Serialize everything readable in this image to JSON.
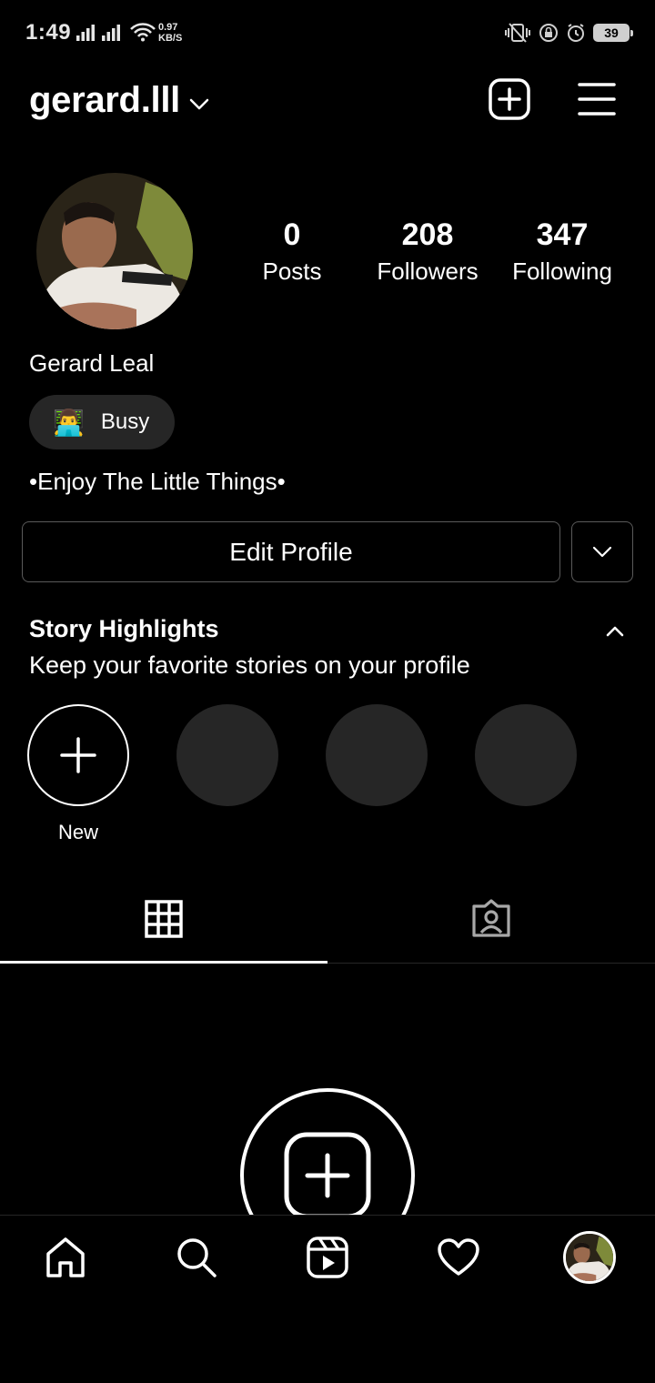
{
  "status_bar": {
    "time": "1:49",
    "net_speed_value": "0.97",
    "net_speed_unit": "KB/S",
    "battery": "39"
  },
  "header": {
    "username": "gerard.lll"
  },
  "profile": {
    "stats": [
      {
        "value": "0",
        "label": "Posts"
      },
      {
        "value": "208",
        "label": "Followers"
      },
      {
        "value": "347",
        "label": "Following"
      }
    ],
    "display_name": "Gerard Leal",
    "status_emoji": "👨‍💻",
    "status_text": "Busy",
    "bio": "•Enjoy The Little Things•",
    "edit_profile_label": "Edit Profile"
  },
  "highlights": {
    "title": "Story Highlights",
    "subtitle": "Keep your favorite stories on your profile",
    "new_label": "New"
  },
  "colors": {
    "background": "#000000",
    "placeholder_circle": "#262626",
    "border": "#5a5a5a"
  },
  "icons": {
    "header": [
      "add-post-icon",
      "menu-icon"
    ],
    "tabs": [
      "grid-icon",
      "tagged-icon"
    ],
    "nav": [
      "home-icon",
      "search-icon",
      "reels-icon",
      "heart-icon",
      "profile-avatar"
    ]
  }
}
